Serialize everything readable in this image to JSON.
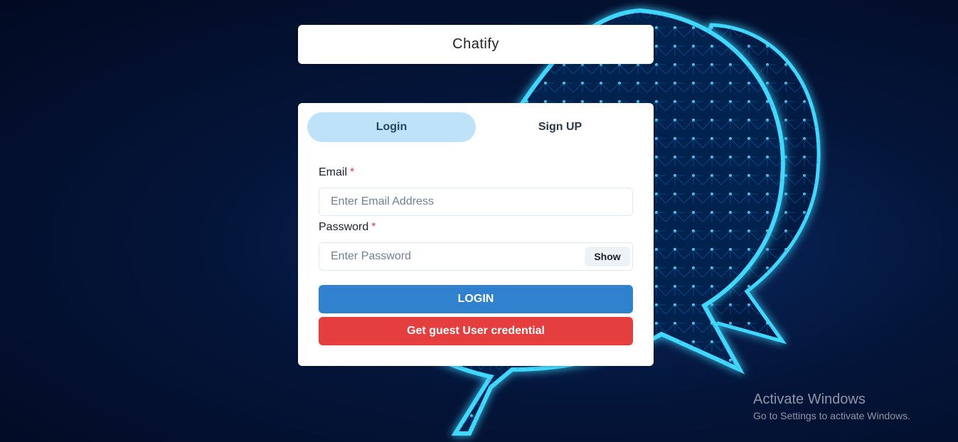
{
  "app": {
    "title": "Chatify"
  },
  "tabs": [
    {
      "label": "Login",
      "active": true
    },
    {
      "label": "Sign UP",
      "active": false
    }
  ],
  "form": {
    "email_label": "Email",
    "email_placeholder": "Enter Email Address",
    "email_value": "",
    "password_label": "Password",
    "password_placeholder": "Enter Password",
    "password_value": "",
    "required_marker": "*",
    "show_label": "Show",
    "login_label": "LOGIN",
    "guest_label": "Get guest User credential"
  },
  "watermark": {
    "title": "Activate Windows",
    "subtitle": "Go to Settings to activate Windows."
  },
  "colors": {
    "accent": "#3182ce",
    "danger": "#e53e3e",
    "tab_active": "#bee3f8",
    "glow": "#3fd8ff"
  }
}
